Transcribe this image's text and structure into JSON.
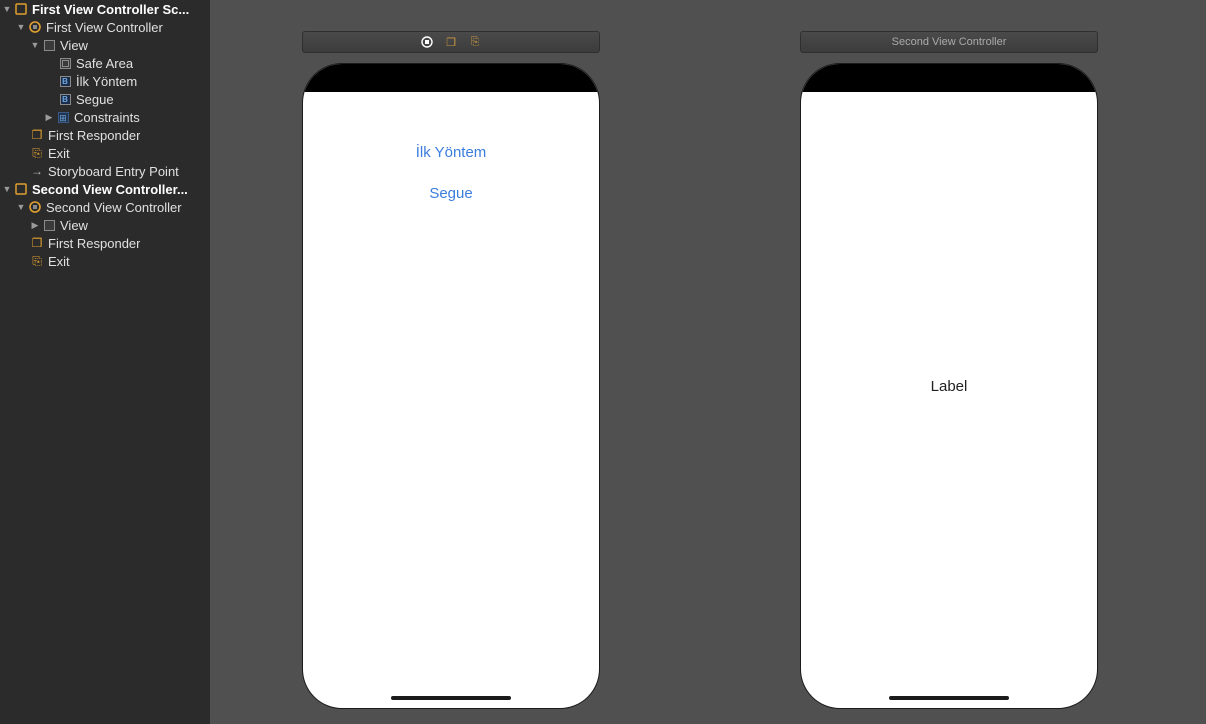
{
  "outline": {
    "scene1": {
      "title": "First View Controller Sc...",
      "vc_title": "First View Controller",
      "view": "View",
      "safe_area": "Safe Area",
      "button1": "İlk Yöntem",
      "button2": "Segue",
      "constraints": "Constraints",
      "first_responder": "First Responder",
      "exit": "Exit",
      "entry_point": "Storyboard Entry Point"
    },
    "scene2": {
      "title": "Second View Controller...",
      "vc_title": "Second View Controller",
      "view": "View",
      "first_responder": "First Responder",
      "exit": "Exit"
    }
  },
  "canvas": {
    "dock2_title": "Second View Controller",
    "phone1": {
      "button1": "İlk Yöntem",
      "button2": "Segue"
    },
    "phone2": {
      "label": "Label"
    }
  }
}
